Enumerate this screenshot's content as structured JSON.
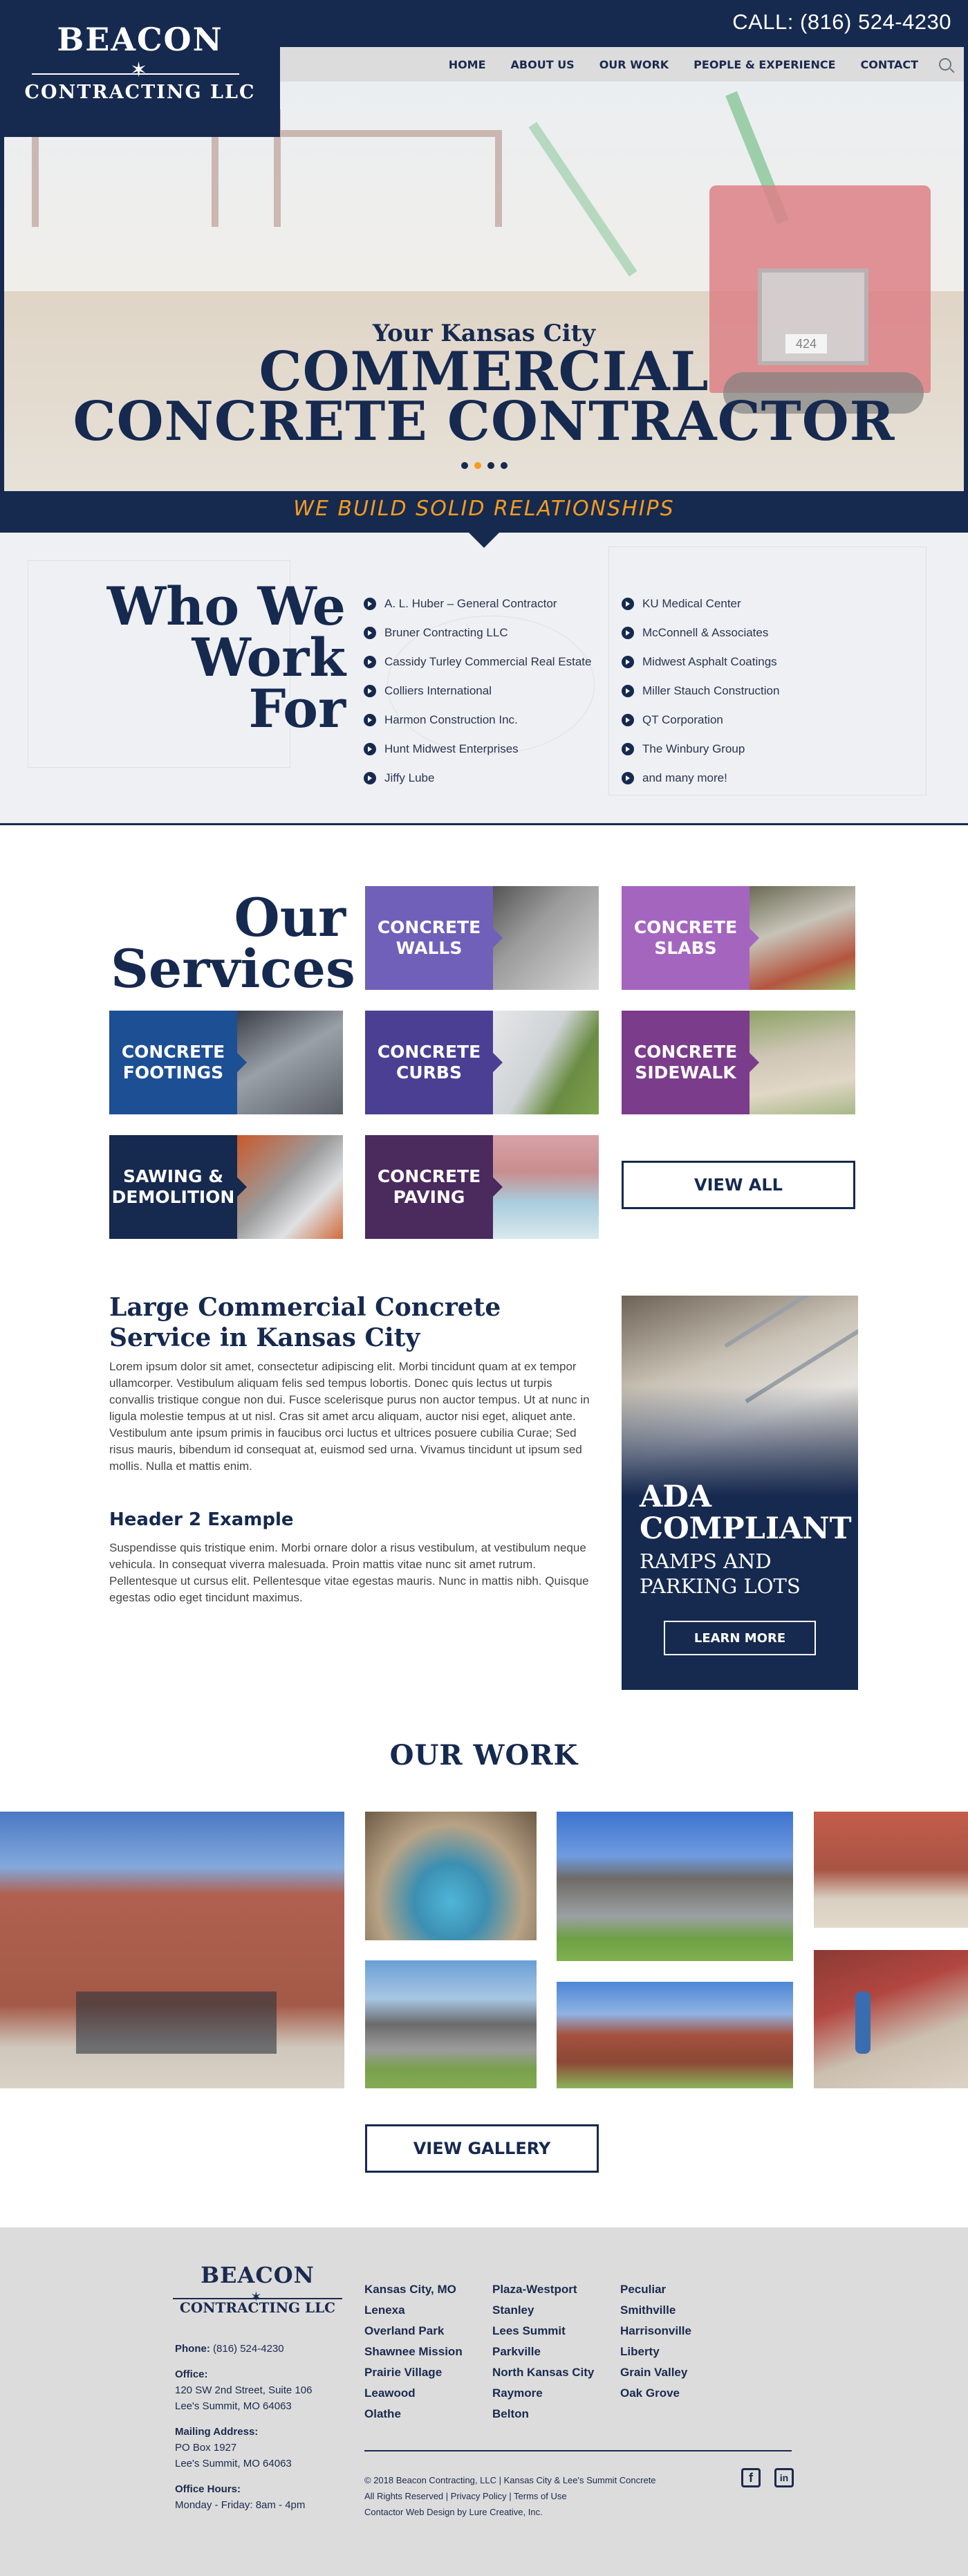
{
  "header": {
    "logo_top": "BEACON",
    "logo_bottom": "CONTRACTING LLC",
    "call": "CALL: (816) 524-4230",
    "nav": [
      "HOME",
      "ABOUT US",
      "OUR WORK",
      "PEOPLE & EXPERIENCE",
      "CONTACT"
    ]
  },
  "hero": {
    "kicker": "Your Kansas City",
    "line1": "COMMERCIAL",
    "line2": "CONCRETE CONTRACTOR",
    "truck_number": "424",
    "slide_count": 4,
    "active_slide": 2,
    "tagline": "WE BUILD SOLID RELATIONSHIPS"
  },
  "who": {
    "title_line1": "Who We",
    "title_line2": "Work For",
    "col1": [
      "A. L. Huber – General Contractor",
      "Bruner Contracting LLC",
      "Cassidy Turley Commercial Real Estate",
      "Colliers International",
      "Harmon Construction Inc.",
      "Hunt Midwest Enterprises",
      "Jiffy Lube"
    ],
    "col2": [
      "KU Medical Center",
      "McConnell & Associates",
      "Midwest Asphalt Coatings",
      "Miller Stauch Construction",
      "QT Corporation",
      "The Winbury Group",
      "and many more!"
    ]
  },
  "services": {
    "title_line1": "Our",
    "title_line2": "Services",
    "tiles": [
      {
        "line1": "CONCRETE",
        "line2": "WALLS",
        "color": "#7160b9"
      },
      {
        "line1": "CONCRETE",
        "line2": "SLABS",
        "color": "#a465bf"
      },
      {
        "line1": "CONCRETE",
        "line2": "FOOTINGS",
        "color": "#1d4f95"
      },
      {
        "line1": "CONCRETE",
        "line2": "CURBS",
        "color": "#4b3f94"
      },
      {
        "line1": "CONCRETE",
        "line2": "SIDEWALK",
        "color": "#7b3c8c"
      },
      {
        "line1": "SAWING &",
        "line2": "DEMOLITION",
        "color": "#16294f"
      },
      {
        "line1": "CONCRETE",
        "line2": "PAVING",
        "color": "#4b2a5e"
      }
    ],
    "view_all": "VIEW ALL"
  },
  "content": {
    "h1": "Large Commercial Concrete Service in Kansas City",
    "p1": "Lorem ipsum dolor sit amet, consectetur adipiscing elit. Morbi tincidunt quam at ex tempor ullamcorper. Vestibulum aliquam felis sed tempus lobortis. Donec quis lectus ut turpis convallis tristique congue non dui. Fusce scelerisque purus non auctor tempus. Ut at nunc in ligula molestie tempus at ut nisl. Cras sit amet arcu aliquam, auctor nisi eget, aliquet ante. Vestibulum ante ipsum primis in faucibus orci luctus et ultrices posuere cubilia Curae; Sed risus mauris, bibendum id consequat at, euismod sed urna. Vivamus tincidunt ut ipsum sed mollis. Nulla et mattis enim.",
    "h2": "Header 2 Example",
    "p2": "Suspendisse quis tristique enim. Morbi ornare dolor a risus vestibulum, at vestibulum neque vehicula. In consequat viverra malesuada. Proin mattis vitae nunc sit amet rutrum. Pellentesque ut cursus elit. Pellentesque vitae egestas mauris. Nunc in mattis nibh. Quisque egestas odio eget tincidunt maximus."
  },
  "ada": {
    "line1": "ADA",
    "line2": "COMPLIANT",
    "sub1": "RAMPS AND",
    "sub2": "PARKING LOTS",
    "button": "LEARN MORE"
  },
  "work": {
    "title": "OUR WORK",
    "gallery_button": "VIEW GALLERY"
  },
  "footer": {
    "logo_top": "BEACON",
    "logo_bottom": "CONTRACTING LLC",
    "phone_label": "Phone:",
    "phone": "(816) 524-4230",
    "office_label": "Office:",
    "office1": "120 SW 2nd Street, Suite 106",
    "office2": "Lee's Summit, MO 64063",
    "mailing_label": "Mailing Address:",
    "mail1": "PO Box 1927",
    "mail2": "Lee's Summit, MO 64063",
    "hours_label": "Office Hours:",
    "hours": "Monday - Friday: 8am - 4pm",
    "cities1": [
      "Kansas City, MO",
      "Lenexa",
      "Overland Park",
      "Shawnee Mission",
      "Prairie Village",
      "Leawood",
      "Olathe"
    ],
    "cities2": [
      "Plaza-Westport",
      "Stanley",
      "Lees Summit",
      "Parkville",
      "North Kansas City",
      "Raymore",
      "Belton"
    ],
    "cities3": [
      "Peculiar",
      "Smithville",
      "Harrisonville",
      "Liberty",
      "Grain Valley",
      "Oak Grove"
    ],
    "copy1": "© 2018 Beacon Contracting, LLC | Kansas City & Lee's Summit Concrete",
    "copy2": "All Rights Reserved | Privacy Policy | Terms of Use",
    "copy3": "Contactor Web Design by Lure Creative, Inc.",
    "facebook": "f",
    "linkedin": "in"
  }
}
